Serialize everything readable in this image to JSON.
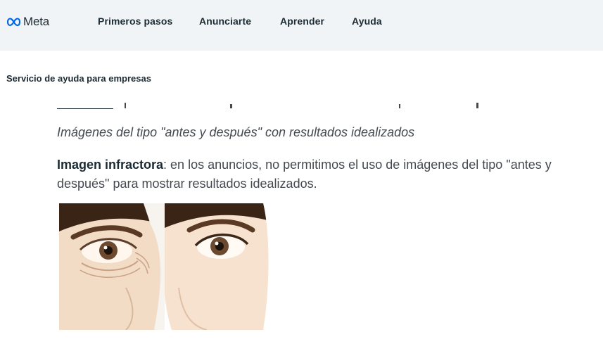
{
  "nav": {
    "logo_text": "Meta",
    "items": [
      "Primeros pasos",
      "Anunciarte",
      "Aprender",
      "Ayuda"
    ]
  },
  "subheader": "Servicio de ayuda para empresas",
  "content": {
    "caption": "Imágenes del tipo \"antes y después\" con resultados idealizados",
    "para_bold": "Imagen infractora",
    "para_rest": ": en los anuncios, no permitimos el uso de imágenes del tipo \"antes y después\" para mostrar resultados idealizados."
  },
  "colors": {
    "nav_bg": "#f1f4f7",
    "text_dark": "#1c2b33",
    "text_body": "#444950",
    "meta_blue": "#0064e0"
  }
}
